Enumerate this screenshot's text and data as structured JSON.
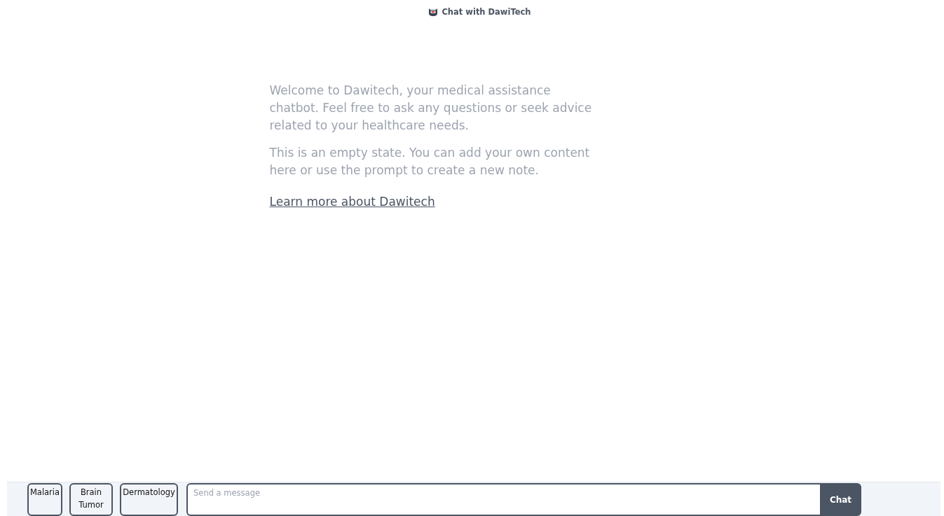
{
  "header": {
    "title": "Chat with DawiTech"
  },
  "welcome": {
    "paragraphs": [
      "Welcome to Dawitech, your medical assistance chatbot. Feel free to ask any questions or seek advice related to your healthcare needs.",
      "This is an empty state. You can add your own content here or use the prompt to create a new note."
    ],
    "link": "Learn more about Dawitech"
  },
  "topics": [
    "Malaria",
    "Brain Tumor",
    "Dermatology"
  ],
  "composer": {
    "placeholder": "Send a message",
    "button": "Chat"
  }
}
